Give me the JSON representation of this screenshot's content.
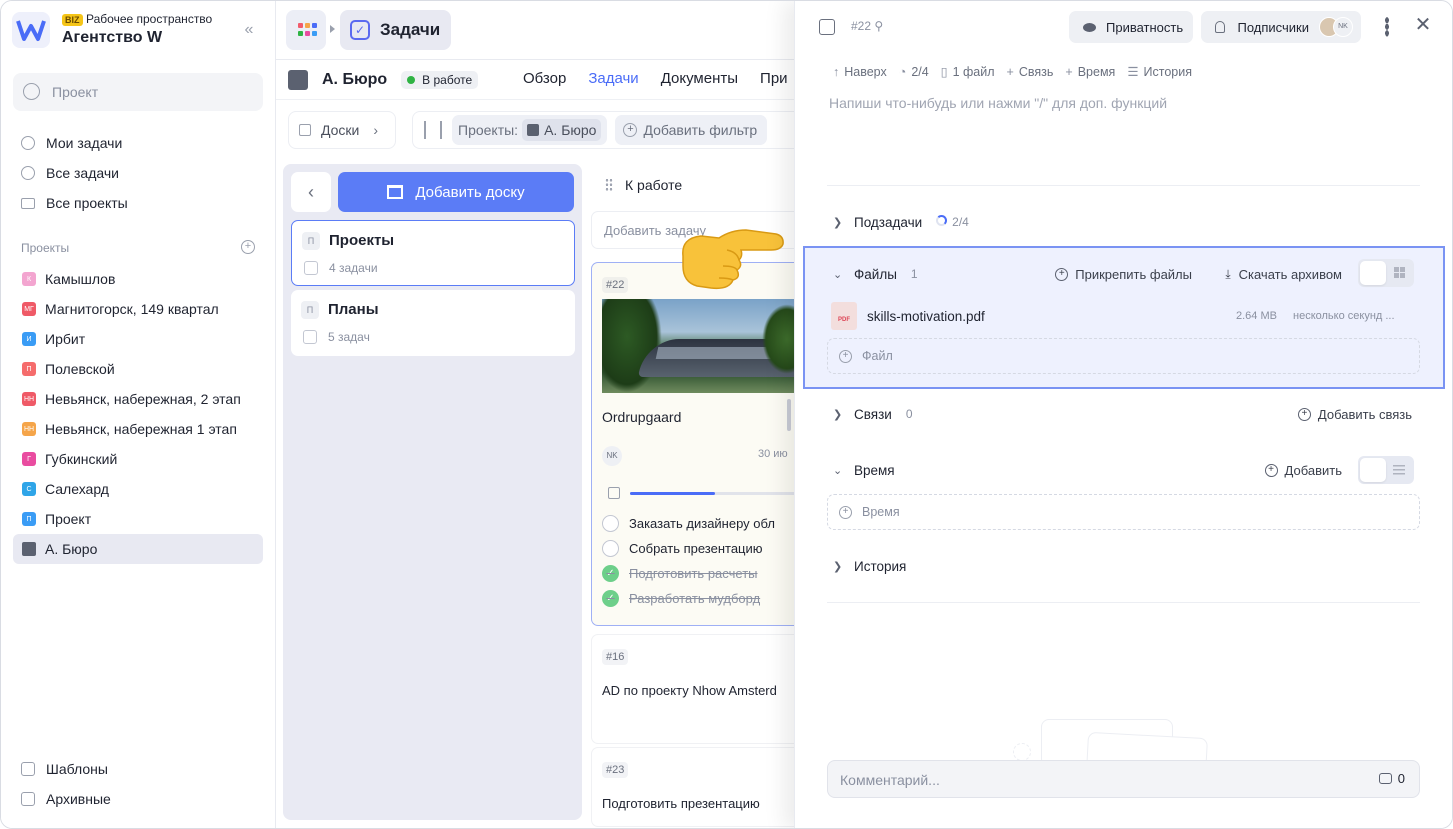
{
  "colors": {
    "accent": "#4a6cf7",
    "button": "#5b7cf6",
    "selected_bg": "#eef1fe",
    "status_green": "#2fb344"
  },
  "workspace": {
    "badge": "BIZ",
    "subtitle": "Рабочее пространство",
    "name": "Агентство W"
  },
  "search": {
    "placeholder": "Проект"
  },
  "nav": [
    {
      "label": "Мои задачи",
      "icon": "check-circle-icon"
    },
    {
      "label": "Все задачи",
      "icon": "check-circle-icon"
    },
    {
      "label": "Все проекты",
      "icon": "folder-icon"
    }
  ],
  "projects_section": {
    "title": "Проекты"
  },
  "projects": [
    {
      "abbr": "К",
      "label": "Камышлов",
      "color": "#f3a5d0"
    },
    {
      "abbr": "МГ",
      "label": "Магнитогорск, 149 квартал",
      "color": "#ef5a67"
    },
    {
      "abbr": "И",
      "label": "Ирбит",
      "color": "#3a9cf5"
    },
    {
      "abbr": "П",
      "label": "Полевской",
      "color": "#f56c6c"
    },
    {
      "abbr": "НН",
      "label": "Невьянск, набережная, 2 этап",
      "color": "#ef5a67"
    },
    {
      "abbr": "НН",
      "label": "Невьянск, набережная 1 этап",
      "color": "#f5a54a"
    },
    {
      "abbr": "Г",
      "label": "Губкинский",
      "color": "#e94ca0"
    },
    {
      "abbr": "С",
      "label": "Салехард",
      "color": "#2fa5e8"
    },
    {
      "abbr": "П",
      "label": "Проект",
      "color": "#3a9cf5"
    },
    {
      "abbr": "",
      "label": "А. Бюро",
      "color": "#5b6170"
    }
  ],
  "footer": [
    {
      "label": "Шаблоны",
      "icon": "templates-icon"
    },
    {
      "label": "Архивные",
      "icon": "archive-icon"
    }
  ],
  "header": {
    "section": "Задачи"
  },
  "project": {
    "name": "А. Бюро",
    "status": "В работе",
    "tabs": [
      {
        "label": "Обзор",
        "active": false
      },
      {
        "label": "Задачи",
        "active": true
      },
      {
        "label": "Документы",
        "active": false
      },
      {
        "label": "При",
        "active": false
      }
    ]
  },
  "toolbar": {
    "boards": "Доски",
    "projects_filter_label": "Проекты:",
    "projects_filter_value": "А. Бюро",
    "add_filter": "Добавить фильтр"
  },
  "boards": {
    "add_label": "Добавить доску",
    "items": [
      {
        "abbr": "П",
        "title": "Проекты",
        "count": "4 задачи",
        "selected": true
      },
      {
        "abbr": "П",
        "title": "Планы",
        "count": "5 задач",
        "selected": false
      }
    ]
  },
  "column": {
    "title": "К работе",
    "add_task": "Добавить задачу",
    "cards": [
      {
        "number": "#22",
        "title": "Ordrupgaard",
        "assignee": "NK",
        "date": "30 ию",
        "progress": 0.5,
        "subtasks": [
          {
            "label": "Заказать дизайнеру обл",
            "done": false
          },
          {
            "label": "Собрать презентацию",
            "done": false
          },
          {
            "label": "Подготовить расчеты",
            "done": true
          },
          {
            "label": "Разработать мудборд",
            "done": true
          }
        ]
      },
      {
        "number": "#16",
        "title": "AD по проекту Nhow Amsterd"
      },
      {
        "number": "#23",
        "title": "Подготовить презентацию"
      }
    ]
  },
  "task_panel": {
    "number": "#22",
    "privacy": "Приватность",
    "subscribers": "Подписчики",
    "subscriber_initials": "NK",
    "meta": [
      {
        "icon": "↑",
        "label": "Наверх"
      },
      {
        "icon": "◔",
        "label": "2/4"
      },
      {
        "icon": "▯",
        "label": "1 файл"
      },
      {
        "icon": "+",
        "label": "Связь"
      },
      {
        "icon": "+",
        "label": "Время"
      },
      {
        "icon": "☰",
        "label": "История"
      }
    ],
    "editor_placeholder": "Напиши что-нибудь или нажми \"/\" для доп. функций",
    "subtasks": {
      "label": "Подзадачи",
      "count": "2/4"
    },
    "files": {
      "label": "Файлы",
      "count": "1",
      "attach": "Прикрепить файлы",
      "download": "Скачать архивом",
      "items": [
        {
          "name": "skills-motivation.pdf",
          "type": "PDF",
          "size": "2.64 MB",
          "time": "несколько секунд ..."
        }
      ],
      "add_placeholder": "Файл"
    },
    "links": {
      "label": "Связи",
      "count": "0",
      "add": "Добавить связь"
    },
    "time": {
      "label": "Время",
      "add": "Добавить",
      "add_placeholder": "Время"
    },
    "history": {
      "label": "История"
    },
    "comment": {
      "placeholder": "Комментарий...",
      "count": "0"
    }
  }
}
